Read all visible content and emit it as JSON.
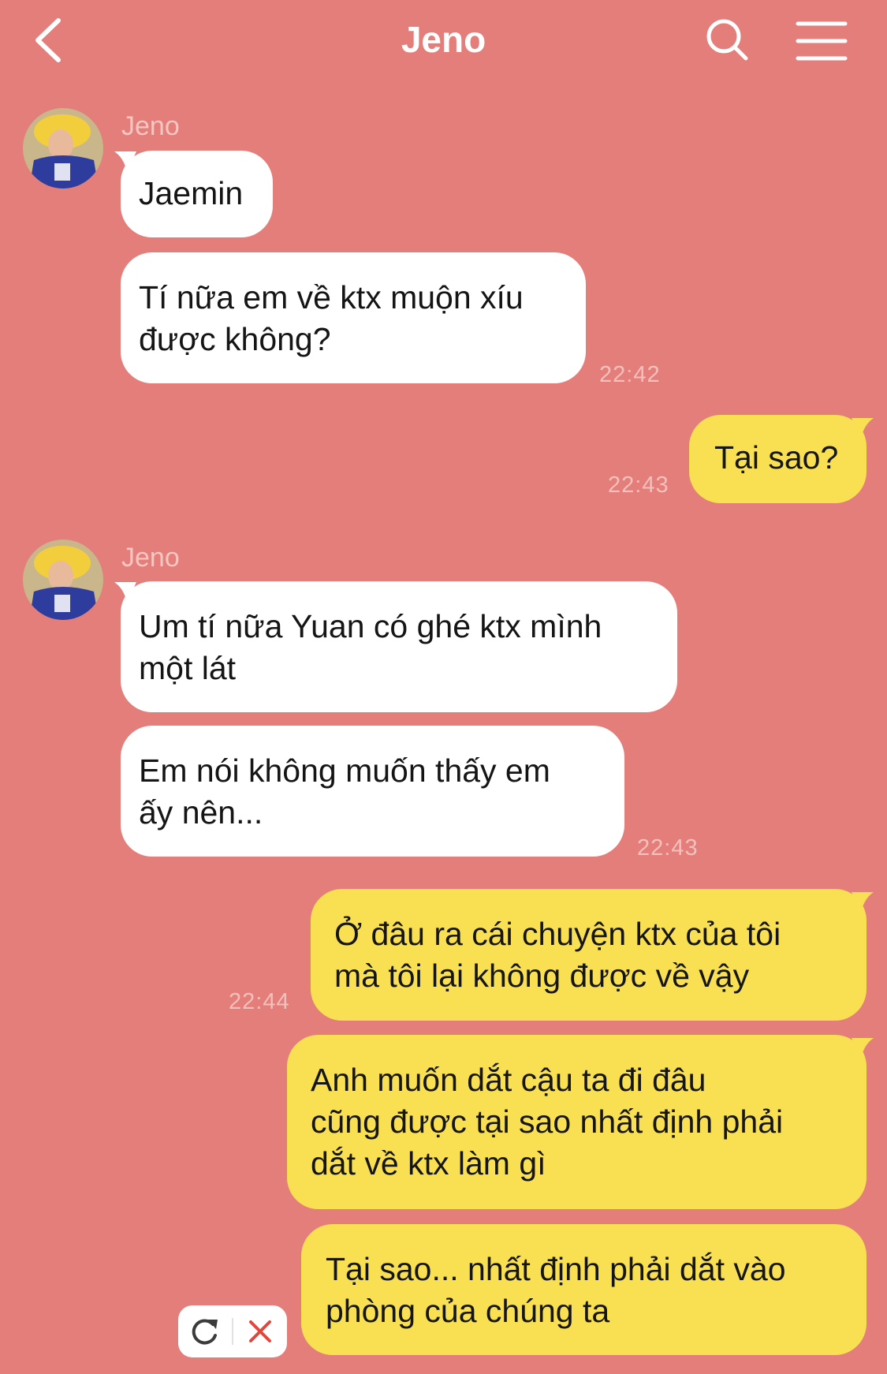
{
  "header": {
    "title": "Jeno",
    "back_icon": "chevron-left-icon",
    "search_icon": "search-icon",
    "menu_icon": "hamburger-menu-icon"
  },
  "colors": {
    "background": "#E37E7A",
    "incoming_bubble": "#FFFFFF",
    "outgoing_bubble": "#F8E052",
    "header_text": "#FFFFFF",
    "resend_delete_color": "#E0473D"
  },
  "messages": [
    {
      "group": "incoming",
      "sender": "Jeno",
      "bubbles": [
        {
          "lines": [
            "Jaemin"
          ]
        },
        {
          "lines": [
            "Tí nữa em về ktx muộn xíu",
            "được không?"
          ]
        }
      ],
      "time": "22:42"
    },
    {
      "group": "outgoing",
      "bubbles": [
        {
          "lines": [
            "Tại sao?"
          ]
        }
      ],
      "time": "22:43"
    },
    {
      "group": "incoming",
      "sender": "Jeno",
      "bubbles": [
        {
          "lines": [
            "Um tí nữa Yuan có ghé ktx mình",
            "một lát"
          ]
        },
        {
          "lines": [
            "Em nói không muốn thấy em",
            "ấy nên..."
          ]
        }
      ],
      "time": "22:43"
    },
    {
      "group": "outgoing",
      "bubbles": [
        {
          "lines": [
            "Ở đâu ra cái chuyện ktx của tôi",
            "mà tôi lại không được về vậy"
          ]
        },
        {
          "lines": [
            "Anh muốn dắt cậu ta đi đâu",
            "cũng được tại sao nhất định phải",
            "dắt về ktx làm gì"
          ]
        },
        {
          "lines": [
            "Tại sao... nhất định phải dắt vào",
            "phòng của chúng ta"
          ]
        }
      ],
      "time": "22:44"
    }
  ],
  "failed_message_actions": {
    "resend_icon": "refresh-icon",
    "delete_icon": "close-icon"
  }
}
